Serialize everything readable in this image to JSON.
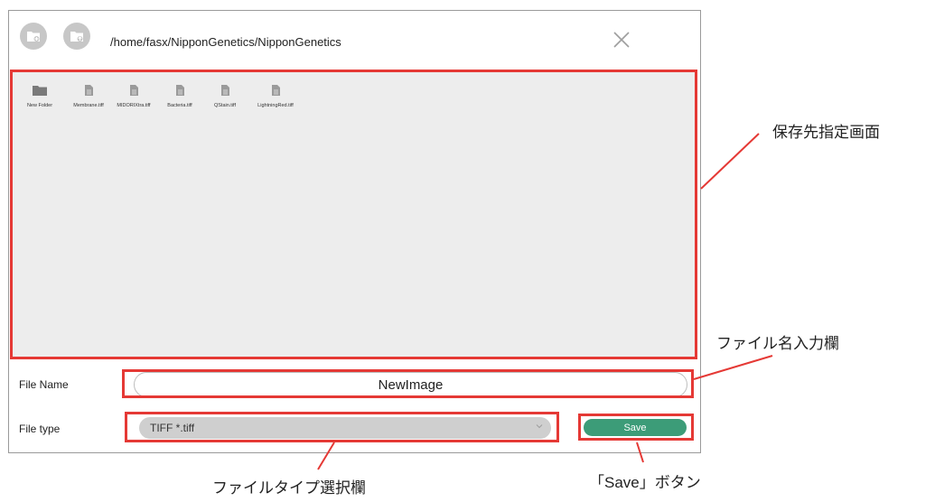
{
  "toolbar": {
    "path": "/home/fasx/NipponGenetics/NipponGenetics"
  },
  "files": [
    {
      "name": "New Folder",
      "type": "folder"
    },
    {
      "name": "Membrane.tiff",
      "type": "file"
    },
    {
      "name": "MIDORIXtra.tiff",
      "type": "file"
    },
    {
      "name": "Bacteria.tiff",
      "type": "file"
    },
    {
      "name": "QStain.tiff",
      "type": "file"
    },
    {
      "name": "LightningRed.tiff",
      "type": "file"
    }
  ],
  "form": {
    "file_name_label": "File Name",
    "file_name_value": "NewImage",
    "file_type_label": "File type",
    "file_type_value": "TIFF *.tiff",
    "save_label": "Save"
  },
  "annotations": {
    "browser": "保存先指定画面",
    "file_name": "ファイル名入力欄",
    "file_type": "ファイルタイプ選択欄",
    "save": "「Save」ボタン"
  },
  "colors": {
    "highlight": "#e53935",
    "save_button": "#3c9c78",
    "browser_bg": "#ededed",
    "round_button": "#c7c7c7"
  }
}
